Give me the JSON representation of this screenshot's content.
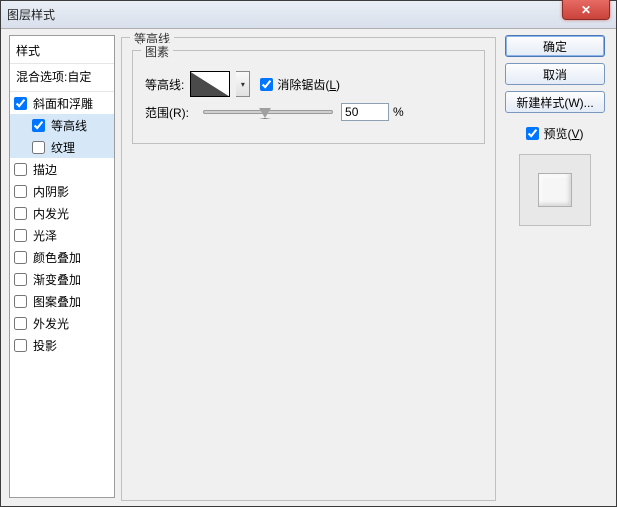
{
  "window": {
    "title": "图层样式"
  },
  "sidebar": {
    "header": "样式",
    "subheader": "混合选项:自定",
    "items": [
      {
        "label": "斜面和浮雕",
        "checked": true,
        "selected": false,
        "indent": false
      },
      {
        "label": "等高线",
        "checked": true,
        "selected": true,
        "indent": true
      },
      {
        "label": "纹理",
        "checked": false,
        "selected": true,
        "indent": true
      },
      {
        "label": "描边",
        "checked": false,
        "selected": false,
        "indent": false
      },
      {
        "label": "内阴影",
        "checked": false,
        "selected": false,
        "indent": false
      },
      {
        "label": "内发光",
        "checked": false,
        "selected": false,
        "indent": false
      },
      {
        "label": "光泽",
        "checked": false,
        "selected": false,
        "indent": false
      },
      {
        "label": "颜色叠加",
        "checked": false,
        "selected": false,
        "indent": false
      },
      {
        "label": "渐变叠加",
        "checked": false,
        "selected": false,
        "indent": false
      },
      {
        "label": "图案叠加",
        "checked": false,
        "selected": false,
        "indent": false
      },
      {
        "label": "外发光",
        "checked": false,
        "selected": false,
        "indent": false
      },
      {
        "label": "投影",
        "checked": false,
        "selected": false,
        "indent": false
      }
    ]
  },
  "center": {
    "outer_legend": "等高线",
    "inner_legend": "图素",
    "contour_label": "等高线:",
    "antialias_label": "消除锯齿(",
    "antialias_key": "L",
    "antialias_tail": ")",
    "antialias_checked": true,
    "range_label": "范围(",
    "range_key": "R",
    "range_tail": "):",
    "range_value": "50",
    "range_unit": "%"
  },
  "right": {
    "ok": "确定",
    "cancel": "取消",
    "new_style": "新建样式(",
    "new_style_key": "W",
    "new_style_tail": ")...",
    "preview_label": "预览(",
    "preview_key": "V",
    "preview_tail": ")",
    "preview_checked": true
  }
}
